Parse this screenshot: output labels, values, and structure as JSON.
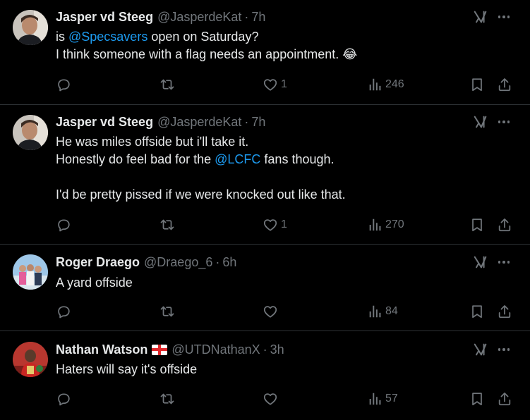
{
  "tweets": [
    {
      "name": "Jasper vd Steeg",
      "handle": "@JasperdeKat",
      "time": "7h",
      "flag": false,
      "text": [
        {
          "t": "is "
        },
        {
          "t": "@Specsavers",
          "m": true
        },
        {
          "t": " open on Saturday?\nI think someone with a flag needs an appointment. 😂"
        }
      ],
      "likes": "1",
      "views": "246"
    },
    {
      "name": "Jasper vd Steeg",
      "handle": "@JasperdeKat",
      "time": "7h",
      "flag": false,
      "text": [
        {
          "t": "He was miles offside but i'll take it.\nHonestly do feel bad for the "
        },
        {
          "t": "@LCFC",
          "m": true
        },
        {
          "t": " fans though.\n\nI'd be pretty pissed if we were knocked out like that."
        }
      ],
      "likes": "1",
      "views": "270"
    },
    {
      "name": "Roger Draego",
      "handle": "@Draego_6",
      "time": "6h",
      "flag": false,
      "text": [
        {
          "t": "A yard offside"
        }
      ],
      "likes": "",
      "views": "84"
    },
    {
      "name": "Nathan Watson",
      "handle": "@UTDNathanX",
      "time": "3h",
      "flag": true,
      "text": [
        {
          "t": "Haters will say it's offside"
        }
      ],
      "likes": "",
      "views": "57"
    }
  ],
  "dot": "·",
  "colors": {
    "background": "#000000",
    "text": "#e7e9ea",
    "muted": "#71767b",
    "mention": "#1d9bf0",
    "divider": "#2f3336"
  },
  "icons": [
    "reply-icon",
    "repost-icon",
    "like-icon",
    "views-icon",
    "bookmark-icon",
    "share-icon",
    "grok-icon",
    "more-icon"
  ]
}
